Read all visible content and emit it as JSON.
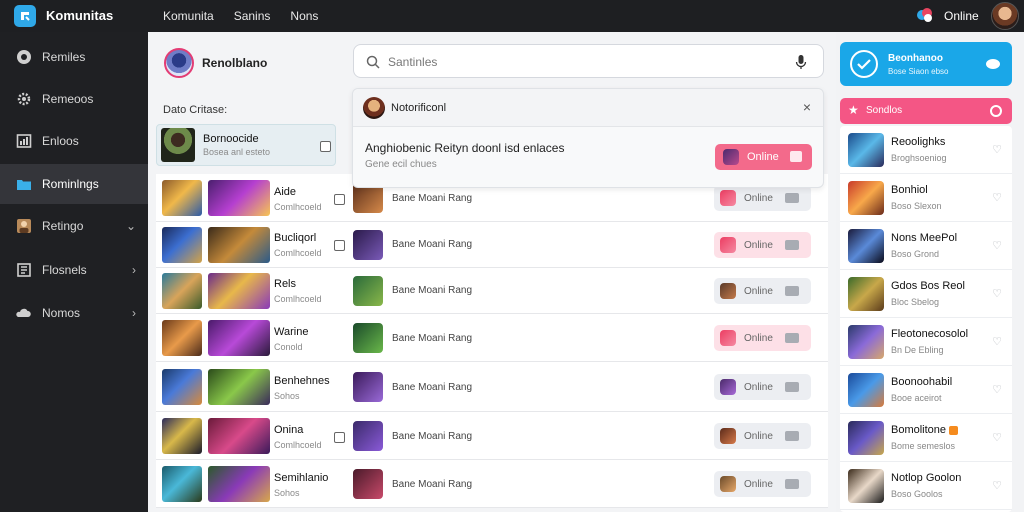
{
  "app": {
    "title": "Komunitas",
    "accent": "#2fa8e8"
  },
  "topnav": [
    "Komunita",
    "Sanins",
    "Nons"
  ],
  "topright": {
    "status": "Online"
  },
  "sidebar": {
    "items": [
      {
        "label": "Remiles",
        "icon": "group-icon"
      },
      {
        "label": "Remeoos",
        "icon": "gear-icon"
      },
      {
        "label": "Enloos",
        "icon": "chart-icon"
      },
      {
        "label": "Rominlngs",
        "icon": "folder-icon",
        "active": true
      },
      {
        "label": "Retingo",
        "icon": "people-icon",
        "chevron": "⌄"
      },
      {
        "label": "Flosnels",
        "icon": "bookmark-icon",
        "chevron": "›"
      },
      {
        "label": "Nomos",
        "icon": "cloud-icon",
        "chevron": "›"
      }
    ]
  },
  "profile": {
    "name": "Renolblano"
  },
  "section_label": "Dato Critase:",
  "search": {
    "placeholder": "Santinles"
  },
  "notification": {
    "title": "Notorificonl",
    "message": "Anghiobenic Reityn doonl isd enlaces",
    "sub": "Gene ecil chues",
    "action": "Online",
    "close": "×"
  },
  "selected": {
    "name": "Bornoocide",
    "sub": "Bosea anl esteto"
  },
  "rows": [
    {
      "name": "Aide",
      "sub": "Comlhcoeld",
      "game": "Bane Moani Rang",
      "status": "Online",
      "pink": false
    },
    {
      "name": "Bucliqorl",
      "sub": "Comlhcoeld",
      "game": "Bane Moani Rang",
      "status": "Online",
      "pink": true
    },
    {
      "name": "Rels",
      "sub": "Comlhcoeld",
      "game": "Bane Moani Rang",
      "status": "Online",
      "pink": false
    },
    {
      "name": "Warine",
      "sub": "Conold",
      "game": "Bane Moani Rang",
      "status": "Online",
      "pink": true
    },
    {
      "name": "Benhehnes",
      "sub": "Sohos",
      "game": "Bane Moani Rang",
      "status": "Online",
      "pink": false
    },
    {
      "name": "Onina",
      "sub": "Comlhcoeld",
      "game": "Bane Moani Rang",
      "status": "Online",
      "pink": false
    },
    {
      "name": "Semihlanio",
      "sub": "Sohos",
      "game": "Bane Moani Rang",
      "status": "Online",
      "pink": false
    }
  ],
  "promo": {
    "title": "Beonhanoo",
    "sub": "Bose Siaon ebso"
  },
  "rail": {
    "header": "Sondlos",
    "items": [
      {
        "name": "Reoolighks",
        "sub": "Broghsoeniog"
      },
      {
        "name": "Bonhiol",
        "sub": "Boso Slexon"
      },
      {
        "name": "Nons MeePol",
        "sub": "Boso Grond"
      },
      {
        "name": "Gdos Bos Reol",
        "sub": "Bloc Sbelog"
      },
      {
        "name": "Fleotonecosolol",
        "sub": "Bn De Ebling"
      },
      {
        "name": "Boonoohabil",
        "sub": "Booe aceirot"
      },
      {
        "name": "Bomolitone",
        "sub": "Bome semeslos"
      },
      {
        "name": "Notlop Goolon",
        "sub": "Boso Goolos"
      }
    ]
  }
}
